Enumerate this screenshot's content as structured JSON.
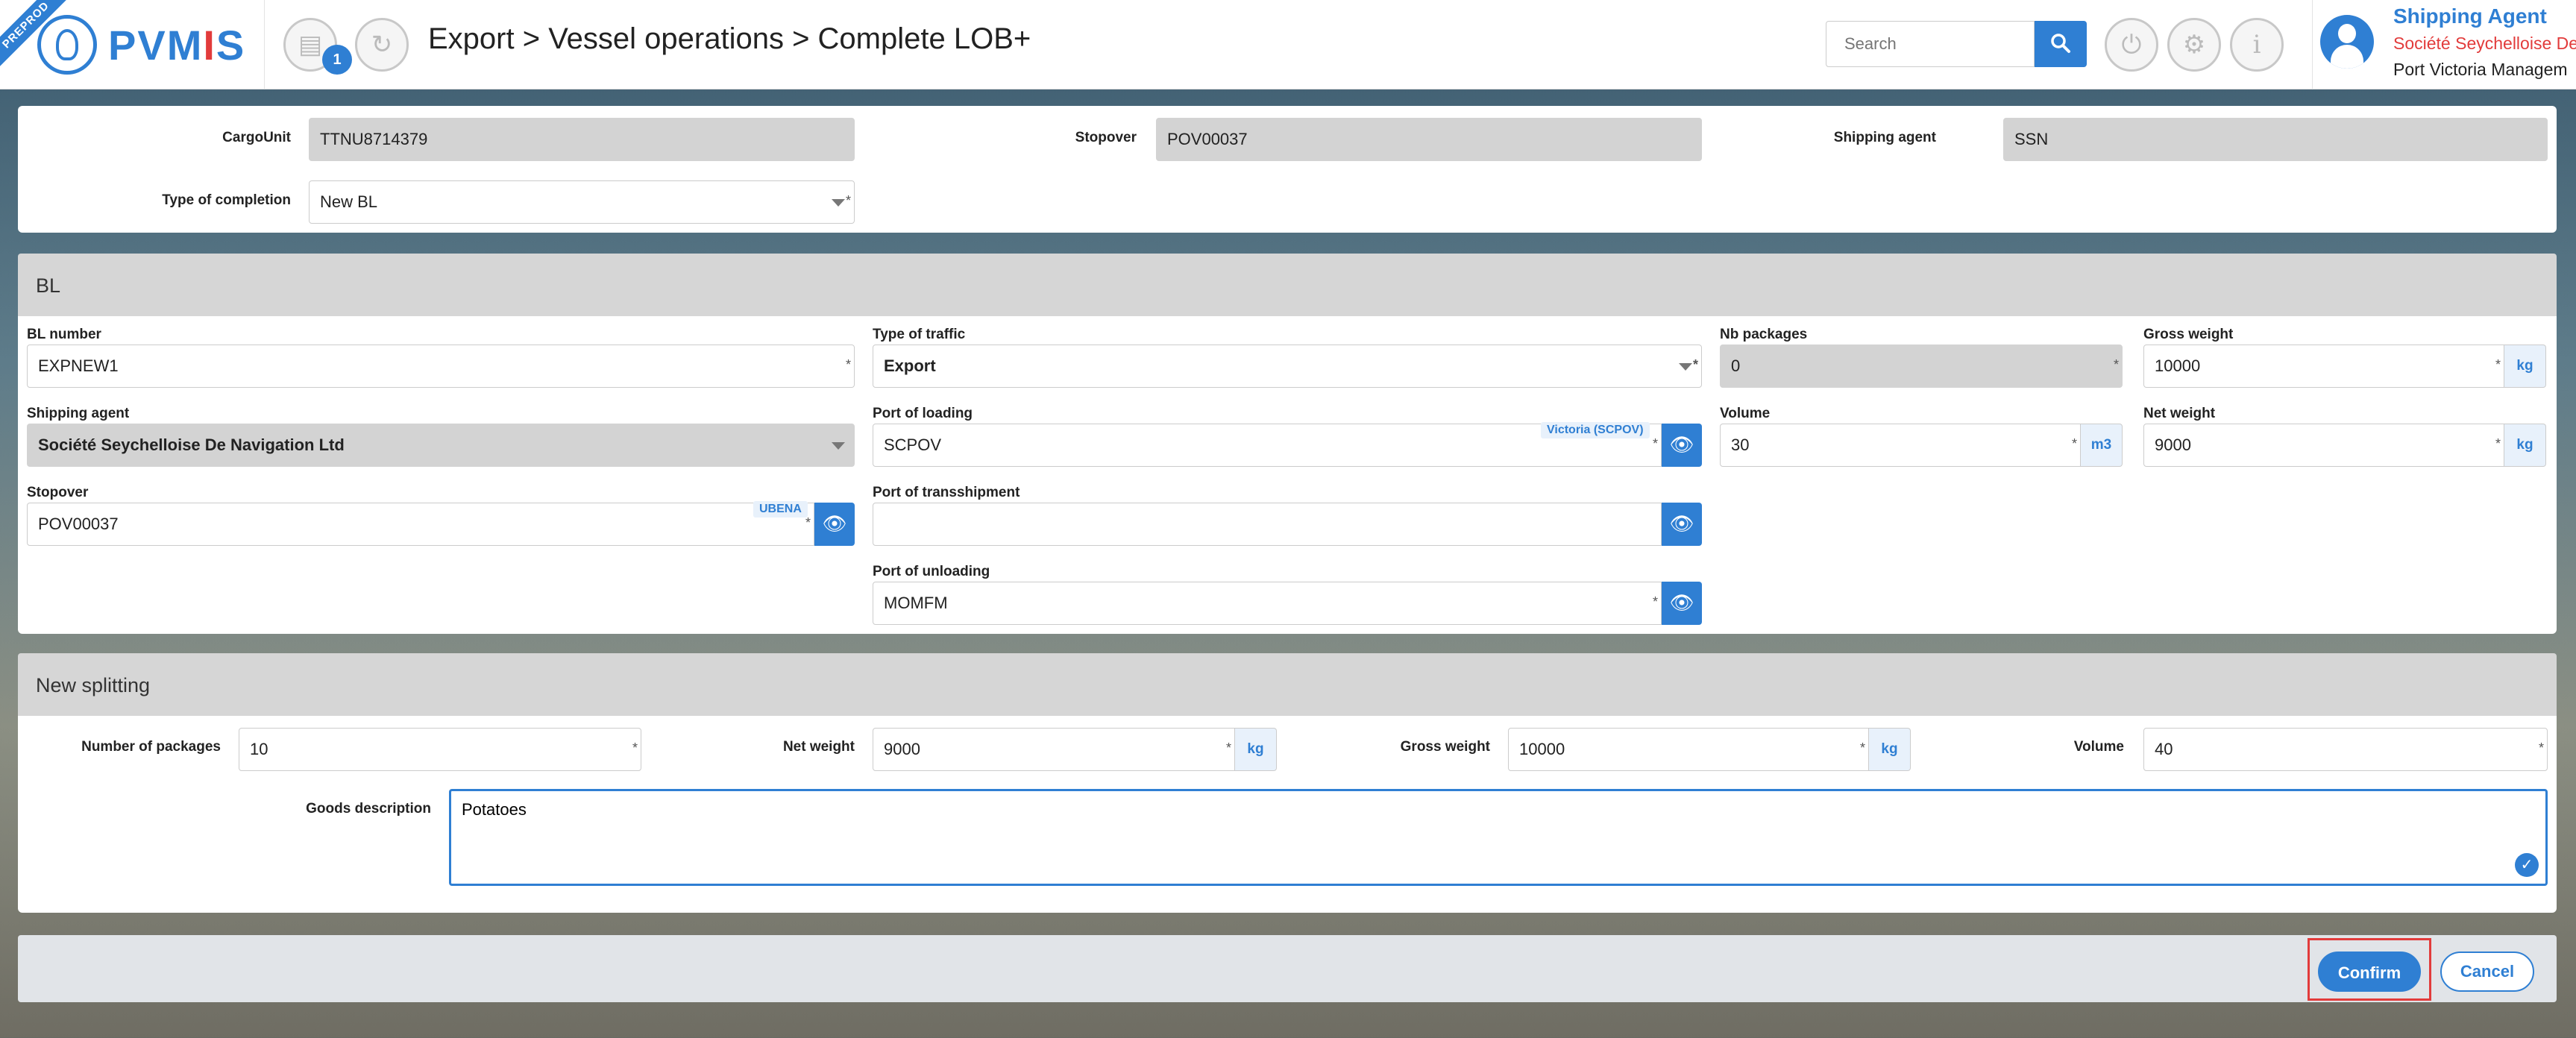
{
  "header": {
    "env_ribbon": "PREPROD",
    "logo_text_1": "PVM",
    "logo_text_2": "I",
    "logo_text_3": "S",
    "notification_count": "1",
    "breadcrumb": "Export > Vessel operations > Complete LOB+",
    "search_placeholder": "Search",
    "user": {
      "role": "Shipping Agent",
      "company": "Société Seychelloise De",
      "organization": "Port Victoria Managem"
    }
  },
  "summary": {
    "cargo_unit_label": "CargoUnit",
    "cargo_unit_value": "TTNU8714379",
    "stopover_label": "Stopover",
    "stopover_value": "POV00037",
    "shipping_agent_label": "Shipping agent",
    "shipping_agent_value": "SSN",
    "completion_type_label": "Type of completion",
    "completion_type_value": "New BL"
  },
  "bl": {
    "section_title": "BL",
    "bl_number_label": "BL number",
    "bl_number_value": "EXPNEW1",
    "traffic_label": "Type of traffic",
    "traffic_value": "Export",
    "nb_packages_label": "Nb packages",
    "nb_packages_value": "0",
    "gross_weight_label": "Gross weight",
    "gross_weight_value": "10000",
    "gross_weight_unit": "kg",
    "shipping_agent_label": "Shipping agent",
    "shipping_agent_value": "Société Seychelloise De Navigation Ltd",
    "port_loading_label": "Port of loading",
    "port_loading_value": "SCPOV",
    "port_loading_tag": "Victoria (SCPOV)",
    "volume_label": "Volume",
    "volume_value": "30",
    "volume_unit": "m3",
    "net_weight_label": "Net weight",
    "net_weight_value": "9000",
    "net_weight_unit": "kg",
    "stopover_label": "Stopover",
    "stopover_value": "POV00037",
    "stopover_tag": "UBENA",
    "port_transshipment_label": "Port of transshipment",
    "port_transshipment_value": "",
    "port_unloading_label": "Port of unloading",
    "port_unloading_value": "MOMFM"
  },
  "splitting": {
    "section_title": "New splitting",
    "packages_label": "Number of packages",
    "packages_value": "10",
    "net_weight_label": "Net weight",
    "net_weight_value": "9000",
    "net_weight_unit": "kg",
    "gross_weight_label": "Gross weight",
    "gross_weight_value": "10000",
    "gross_weight_unit": "kg",
    "volume_label": "Volume",
    "volume_value": "40",
    "goods_label": "Goods description",
    "goods_value": "Potatoes"
  },
  "footer": {
    "confirm_label": "Confirm",
    "cancel_label": "Cancel"
  },
  "colors": {
    "accent": "#2f7fd3",
    "alert": "#e23b3b"
  },
  "icons": [
    "document-icon",
    "refresh-icon",
    "search-icon",
    "power-icon",
    "settings-icon",
    "info-icon",
    "eye-add-icon",
    "check-icon"
  ]
}
